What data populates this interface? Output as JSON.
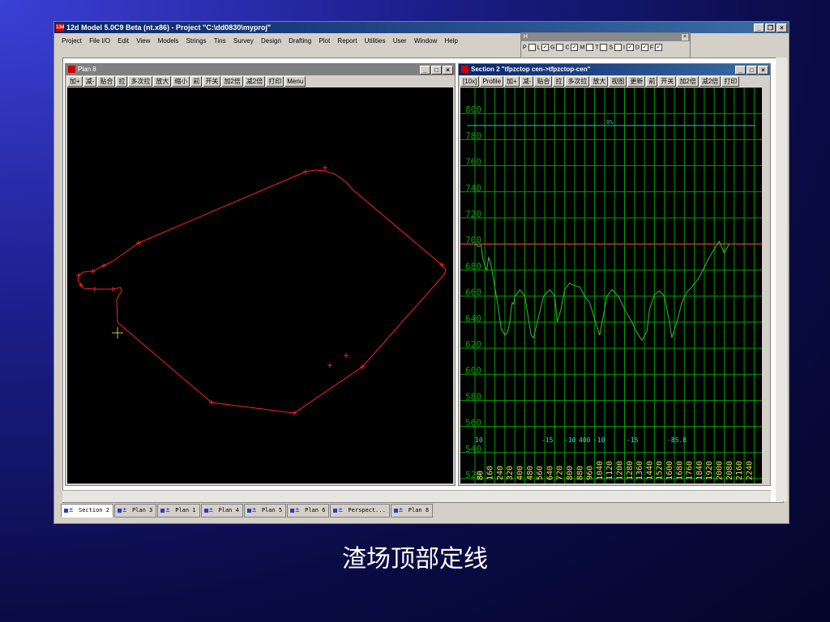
{
  "app": {
    "title": "12d Model 5.0C9 Beta (nt.x86) - Project \"C:\\dd0830\\myproj\"",
    "icon_text": "12d",
    "menu": [
      "Project",
      "File I/O",
      "Edit",
      "View",
      "Models",
      "Strings",
      "Tins",
      "Survey",
      "Design",
      "Drafting",
      "Plot",
      "Report",
      "Utilities",
      "User",
      "Window",
      "Help"
    ]
  },
  "palette": {
    "title": "H",
    "items": [
      {
        "label": "P",
        "checked": false
      },
      {
        "label": "L",
        "checked": true
      },
      {
        "label": "G",
        "checked": false
      },
      {
        "label": "C",
        "checked": true
      },
      {
        "label": "M",
        "checked": false
      },
      {
        "label": "T",
        "checked": false
      },
      {
        "label": "S",
        "checked": false
      },
      {
        "label": "I",
        "checked": true
      },
      {
        "label": "D",
        "checked": true
      },
      {
        "label": "F",
        "checked": true
      }
    ]
  },
  "plan": {
    "title": "Plan 8",
    "toolbar": [
      "加+",
      "减-",
      "贴合",
      "拉",
      "多次拉",
      "放大",
      "缩小",
      "前",
      "开关",
      "加2倍",
      "减2倍",
      "打印",
      "Menu"
    ]
  },
  "section": {
    "title": "Section 2 \"tfpzctop cen->tfpzctop-cen\"",
    "toolbar": [
      "[10x]",
      "Profile",
      "加+",
      "减-",
      "贴合",
      "拉",
      "多次拉",
      "放大",
      "视图",
      "更新",
      "前",
      "开关",
      "加2倍",
      "减2倍",
      "打印"
    ],
    "grade_label": "0%",
    "y_labels": [
      "820",
      "800",
      "780",
      "760",
      "740",
      "720",
      "700",
      "680",
      "660",
      "640",
      "620",
      "600",
      "580",
      "560",
      "540",
      "520"
    ],
    "x_labels": [
      "80",
      "160",
      "240",
      "320",
      "400",
      "480",
      "560",
      "640",
      "720",
      "800",
      "880",
      "960",
      "1040",
      "1120",
      "1200",
      "1280",
      "1360",
      "1440",
      "1520",
      "1600",
      "1680",
      "1760",
      "1840",
      "1920",
      "2000",
      "2080",
      "2160",
      "2240"
    ],
    "bottom_labels": [
      "10",
      "-15",
      "-10",
      "400",
      "-10",
      "-15",
      "-85.8"
    ],
    "reference_level": "700"
  },
  "tabs": [
    "Section 2",
    "Plan 3",
    "Plan 1",
    "Plan 4",
    "Plan 5",
    "Plan 6",
    "Perspect...",
    "Plan 8"
  ],
  "caption": "渣场顶部定线",
  "colors": {
    "accent": "#0a246a",
    "grid": "#00a000",
    "plan_line": "#ff2020",
    "profile": "#30c030"
  }
}
